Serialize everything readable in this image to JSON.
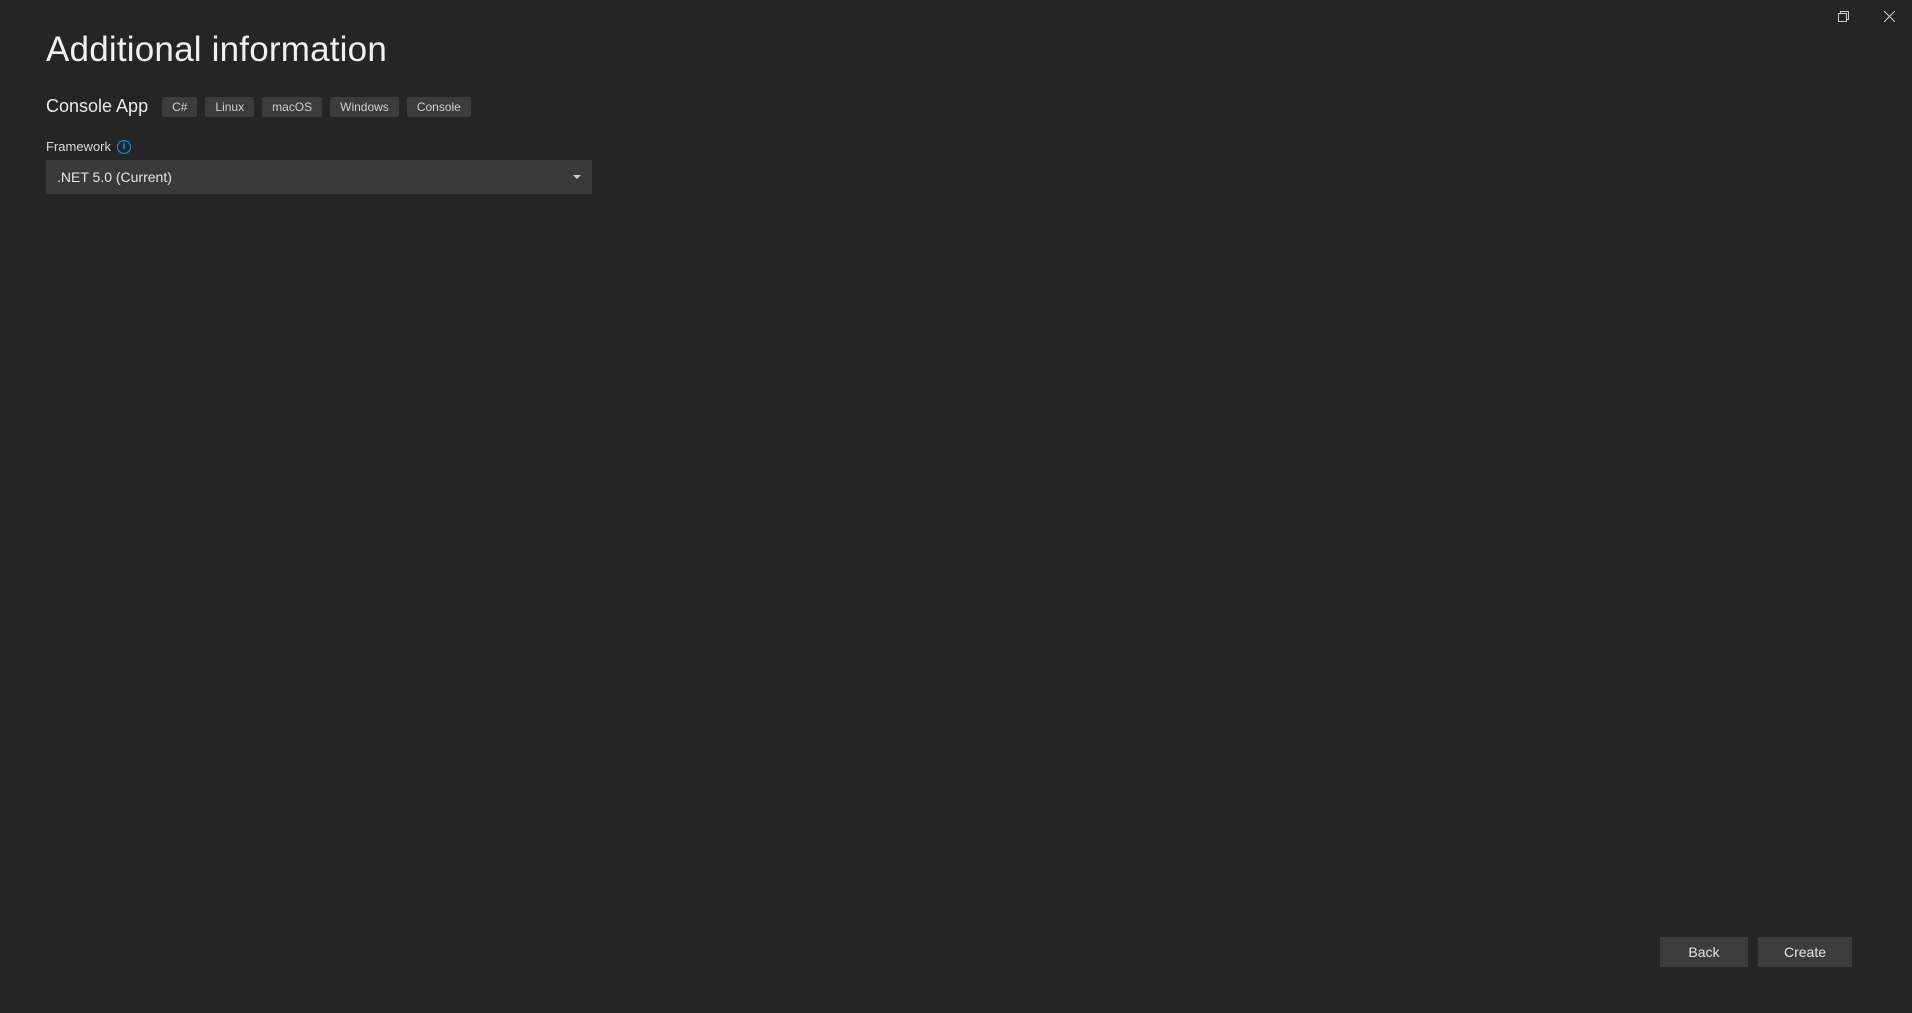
{
  "page_title": "Additional information",
  "template": {
    "name": "Console App",
    "tags": [
      "C#",
      "Linux",
      "macOS",
      "Windows",
      "Console"
    ]
  },
  "framework_field": {
    "label": "Framework",
    "selected": ".NET 5.0 (Current)"
  },
  "footer": {
    "back_label": "Back",
    "create_label": "Create"
  }
}
